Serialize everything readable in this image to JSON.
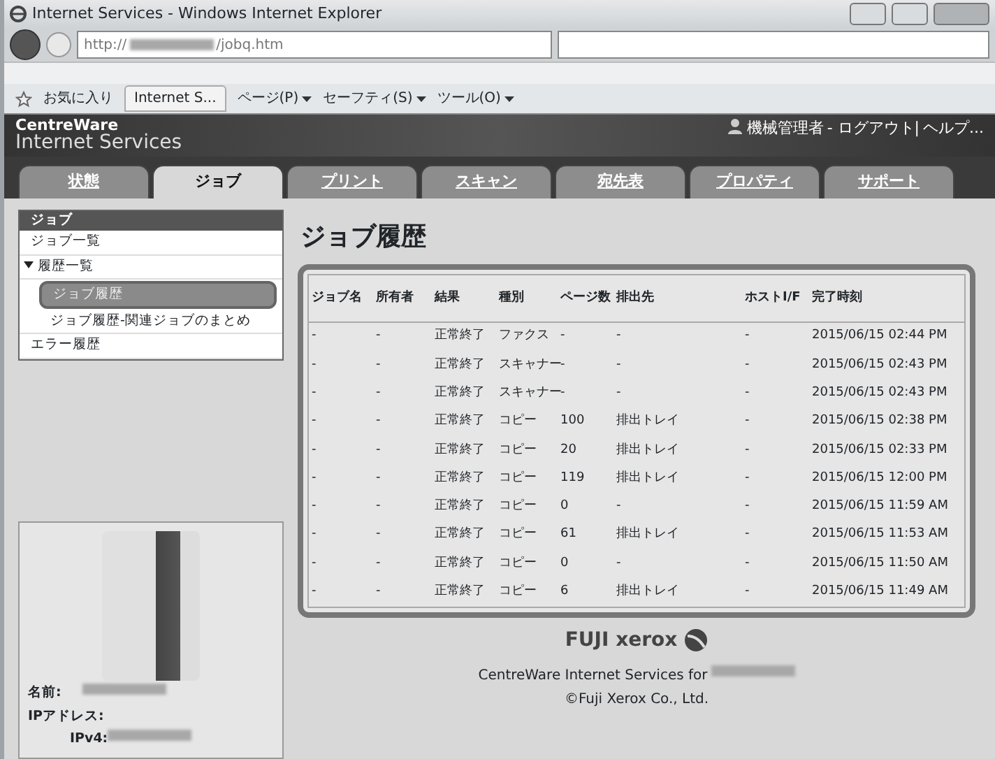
{
  "window": {
    "title": "Internet Services - Windows Internet Explorer"
  },
  "address_bar": {
    "url_prefix": "http://",
    "url_path": "/jobq.htm"
  },
  "command_bar": {
    "favorites": "お気に入り",
    "tab_title": "Internet S...",
    "menus": [
      "ページ(P)",
      "セーフティ(S)",
      "ツール(O)"
    ]
  },
  "header": {
    "brand_top": "CentreWare",
    "brand_bottom": "Internet Services",
    "user": "機械管理者",
    "links": [
      "- ログアウト|",
      "ヘルプ..."
    ]
  },
  "tabs": [
    {
      "label": "状態",
      "selected": false
    },
    {
      "label": "ジョブ",
      "selected": true
    },
    {
      "label": "プリント",
      "selected": false
    },
    {
      "label": "スキャン",
      "selected": false
    },
    {
      "label": "宛先表",
      "selected": false
    },
    {
      "label": "プロパティ",
      "selected": false
    },
    {
      "label": "サポート",
      "selected": false
    }
  ],
  "sidebar": {
    "title": "ジョブ",
    "items": [
      {
        "label": "ジョブ一覧",
        "selected": false
      },
      {
        "label": "履歴一覧",
        "selected": false,
        "expanded": true,
        "children": [
          {
            "label": "ジョブ履歴",
            "selected": true
          },
          {
            "label": "ジョブ履歴-関連ジョブのまとめ",
            "selected": false
          }
        ]
      },
      {
        "label": "エラー履歴",
        "selected": false
      }
    ]
  },
  "device": {
    "name_label": "名前:",
    "ip_label": "IPアドレス:",
    "ipv4_label": "IPv4:"
  },
  "page_title": "ジョブ履歴",
  "table": {
    "columns": [
      "ジョブ名",
      "所有者",
      "結果",
      "種別",
      "ページ数",
      "排出先",
      "ホストI/F",
      "完了時刻"
    ],
    "rows": [
      [
        "-",
        "-",
        "正常終了",
        "ファクス",
        "-",
        "-",
        "-",
        "2015/06/15 02:44 PM"
      ],
      [
        "-",
        "-",
        "正常終了",
        "スキャナー",
        "-",
        "-",
        "-",
        "2015/06/15 02:43 PM"
      ],
      [
        "-",
        "-",
        "正常終了",
        "スキャナー",
        "-",
        "-",
        "-",
        "2015/06/15 02:43 PM"
      ],
      [
        "-",
        "-",
        "正常終了",
        "コピー",
        "100",
        "排出トレイ",
        "-",
        "2015/06/15 02:38 PM"
      ],
      [
        "-",
        "-",
        "正常終了",
        "コピー",
        "20",
        "排出トレイ",
        "-",
        "2015/06/15 02:33 PM"
      ],
      [
        "-",
        "-",
        "正常終了",
        "コピー",
        "119",
        "排出トレイ",
        "-",
        "2015/06/15 12:00 PM"
      ],
      [
        "-",
        "-",
        "正常終了",
        "コピー",
        "0",
        "-",
        "-",
        "2015/06/15 11:59 AM"
      ],
      [
        "-",
        "-",
        "正常終了",
        "コピー",
        "61",
        "排出トレイ",
        "-",
        "2015/06/15 11:53 AM"
      ],
      [
        "-",
        "-",
        "正常終了",
        "コピー",
        "0",
        "-",
        "-",
        "2015/06/15 11:50 AM"
      ],
      [
        "-",
        "-",
        "正常終了",
        "コピー",
        "6",
        "排出トレイ",
        "-",
        "2015/06/15 11:49 AM"
      ]
    ]
  },
  "footer": {
    "logo": "FUJI xerox",
    "line1": "CentreWare Internet Services for",
    "line2": "©Fuji Xerox Co., Ltd."
  }
}
